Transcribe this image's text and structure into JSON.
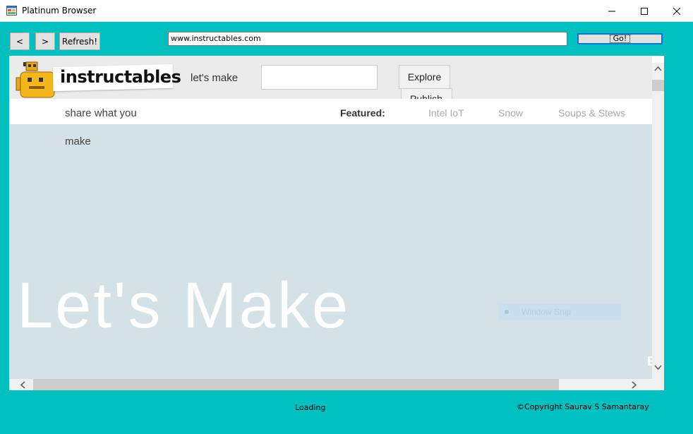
{
  "window": {
    "title": "Platinum Browser",
    "accent_color": "#00BFBF"
  },
  "toolbar": {
    "back_label": "<",
    "forward_label": ">",
    "refresh_label": "Refresh!",
    "address_value": "www.instructables.com",
    "go_label": "Go!"
  },
  "site": {
    "logo_text": "instructables",
    "lets_make": "let's make",
    "explore_label": "Explore",
    "publish_label": "Publish",
    "share_text": "share what you",
    "make_text": "make",
    "featured_label": "Featured:",
    "featured_links": [
      "Intel IoT",
      "Snow",
      "Soups & Stews"
    ],
    "hero_title": "Let's Make",
    "snip_overlay_text": "Window Snip",
    "edge_char": "E"
  },
  "status": {
    "loading": "Loading",
    "copyright": "©Copyright Saurav S Samantaray"
  }
}
